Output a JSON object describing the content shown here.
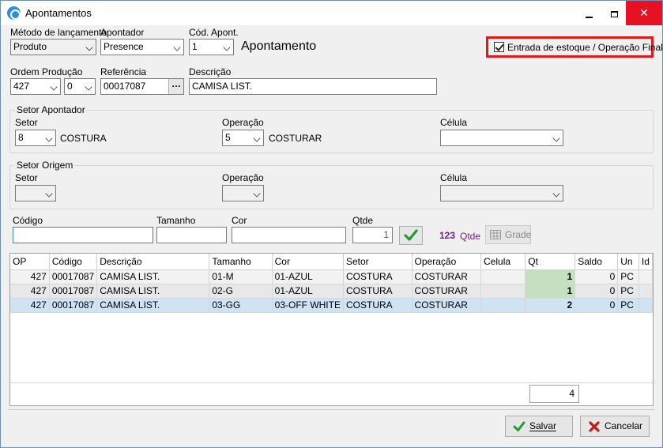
{
  "window": {
    "title": "Apontamentos"
  },
  "header": {
    "metodo_label": "Método de lançamento",
    "metodo_value": "Produto",
    "apontador_label": "Apontador",
    "apontador_value": "Presence",
    "cod_apont_label": "Cód. Apont.",
    "cod_apont_value": "1",
    "apontamento_text": "Apontamento",
    "entrada_estoque_label": "Entrada de estoque / Operação Final",
    "entrada_estoque_checked": true
  },
  "ordem": {
    "ordem_producao_label": "Ordem Produção",
    "ordem_value": "427",
    "ordem_sub_value": "0",
    "referencia_label": "Referência",
    "referencia_value": "00017087",
    "descricao_label": "Descrição",
    "descricao_value": "CAMISA LIST."
  },
  "setor_apontador": {
    "title": "Setor Apontador",
    "setor_label": "Setor",
    "setor_value": "8",
    "setor_name": "COSTURA",
    "operacao_label": "Operação",
    "operacao_value": "5",
    "operacao_name": "COSTURAR",
    "celula_label": "Célula",
    "celula_value": ""
  },
  "setor_origem": {
    "title": "Setor Origem",
    "setor_label": "Setor",
    "setor_value": "",
    "operacao_label": "Operação",
    "operacao_value": "",
    "celula_label": "Célula",
    "celula_value": ""
  },
  "entry": {
    "codigo_label": "Código",
    "codigo_value": "",
    "tamanho_label": "Tamanho",
    "tamanho_value": "",
    "cor_label": "Cor",
    "cor_value": "",
    "qtde_label": "Qtde",
    "qtde_value": "1",
    "counter_value": "123",
    "counter_unit": "Qtde",
    "grade_label": "Grade"
  },
  "grid": {
    "columns": [
      "OP",
      "Código",
      "Descrição",
      "Tamanho",
      "Cor",
      "Setor",
      "Operação",
      "Celula",
      "Qt",
      "Saldo",
      "Un",
      "Id"
    ],
    "rows": [
      [
        "427",
        "00017087",
        "CAMISA LIST.",
        "01-M",
        "01-AZUL",
        "COSTURA",
        "COSTURAR",
        "",
        "1",
        "0",
        "PC",
        ""
      ],
      [
        "427",
        "00017087",
        "CAMISA LIST.",
        "02-G",
        "01-AZUL",
        "COSTURA",
        "COSTURAR",
        "",
        "1",
        "0",
        "PC",
        ""
      ],
      [
        "427",
        "00017087",
        "CAMISA LIST.",
        "03-GG",
        "03-OFF WHITE",
        "COSTURA",
        "COSTURAR",
        "",
        "2",
        "0",
        "PC",
        ""
      ]
    ],
    "total": "4"
  },
  "buttons": {
    "salvar": "Salvar",
    "cancelar": "Cancelar"
  },
  "colors": {
    "highlight": "#e01a1a",
    "accent": "#2b8fd9",
    "counter": "#7a1a8a"
  }
}
